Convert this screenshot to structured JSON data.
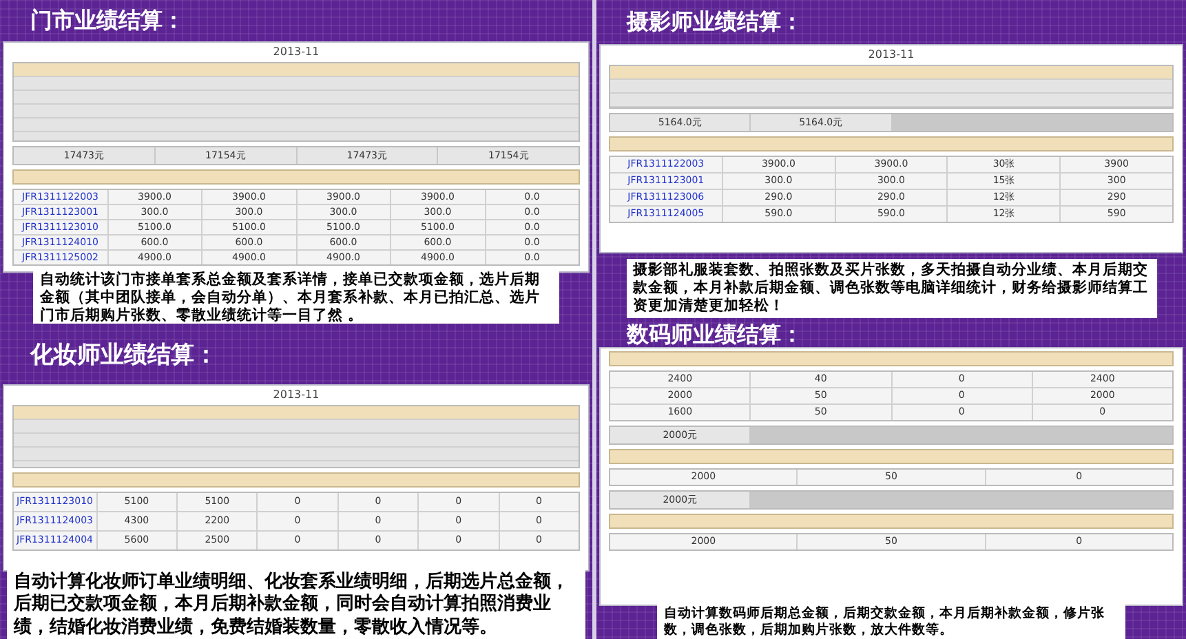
{
  "panels": [
    {
      "title": "门市业绩结算：",
      "report": {
        "title": "2013-11",
        "sections": [
          {
            "summary": [
              "17473元",
              "17154元",
              "17473元",
              "17154元"
            ],
            "rows": [
              {
                "order": "JFR1311122003",
                "cells": [
                  "3900.0",
                  "3900.0",
                  "3900.0",
                  "3900.0",
                  "0.0"
                ]
              },
              {
                "order": "JFR1311123001",
                "cells": [
                  "300.0",
                  "300.0",
                  "300.0",
                  "300.0",
                  "0.0"
                ]
              },
              {
                "order": "JFR1311123010",
                "cells": [
                  "5100.0",
                  "5100.0",
                  "5100.0",
                  "5100.0",
                  "0.0"
                ]
              },
              {
                "order": "JFR1311124010",
                "cells": [
                  "600.0",
                  "600.0",
                  "600.0",
                  "600.0",
                  "0.0"
                ]
              },
              {
                "order": "JFR1311125002",
                "cells": [
                  "4900.0",
                  "4900.0",
                  "4900.0",
                  "4900.0",
                  "0.0"
                ]
              }
            ]
          }
        ]
      },
      "caption": "自动统计该门市接单套系总金额及套系详情，接单已交款项金额，选片后期金额（其中团队接单，会自动分单）、本月套系补款、本月已拍汇总、选片门市后期购片张数、零散业绩统计等一目了然 。"
    },
    {
      "title": "摄影师业绩结算：",
      "report": {
        "title": "2013-11",
        "sections": [
          {
            "summary": [
              "5164.0元",
              "5164.0元"
            ],
            "rows": [
              {
                "order": "JFR1311122003",
                "cells": [
                  "3900.0",
                  "3900.0",
                  "30张",
                  "3900"
                ]
              },
              {
                "order": "JFR1311123001",
                "cells": [
                  "300.0",
                  "300.0",
                  "15张",
                  "300"
                ]
              },
              {
                "order": "JFR1311123006",
                "cells": [
                  "290.0",
                  "290.0",
                  "12张",
                  "290"
                ]
              },
              {
                "order": "JFR1311124005",
                "cells": [
                  "590.0",
                  "590.0",
                  "12张",
                  "590"
                ]
              }
            ]
          }
        ]
      },
      "caption": "摄影部礼服装套数、拍照张数及买片张数，多天拍摄自动分业绩、本月后期交款金额，本月补款后期金额、调色张数等电脑详细统计，财务给摄影师结算工资更加清楚更加轻松！"
    },
    {
      "title": "化妆师业绩结算：",
      "report": {
        "title": "2013-11",
        "sections": [
          {
            "rows": [
              {
                "order": "JFR1311123010",
                "cells": [
                  "5100",
                  "5100",
                  "0",
                  "0",
                  "0",
                  "0"
                ]
              },
              {
                "order": "JFR1311124003",
                "cells": [
                  "4300",
                  "2200",
                  "0",
                  "0",
                  "0",
                  "0"
                ]
              },
              {
                "order": "JFR1311124004",
                "cells": [
                  "5600",
                  "2500",
                  "0",
                  "0",
                  "0",
                  "0"
                ]
              }
            ]
          }
        ]
      },
      "caption": "自动计算化妆师订单业绩明细、化妆套系业绩明细，后期选片总金额，后期已交款项金额，本月后期补款金额，同时会自动计算拍照消费业绩，结婚化妆消费业绩，免费结婚装数量，零散收入情况等。"
    },
    {
      "title": "数码师业绩结算：",
      "report": {
        "sections": [
          {
            "rows": [
              {
                "cells": [
                  "2400",
                  "40",
                  "0",
                  "2400"
                ]
              },
              {
                "cells": [
                  "2000",
                  "50",
                  "0",
                  "2000"
                ]
              },
              {
                "cells": [
                  "1600",
                  "50",
                  "0",
                  "0"
                ]
              }
            ]
          },
          {
            "summary": [
              "2000元"
            ],
            "rows": [
              {
                "cells": [
                  "2000",
                  "50",
                  "0"
                ]
              }
            ]
          },
          {
            "summary": [
              "2000元"
            ],
            "rows": [
              {
                "cells": [
                  "2000",
                  "50",
                  "0"
                ]
              }
            ]
          }
        ]
      },
      "caption": "自动计算数码师后期总金额，后期交款金额，本月后期补款金额，修片张数，调色张数，后期加购片张数，放大件数等。"
    }
  ]
}
